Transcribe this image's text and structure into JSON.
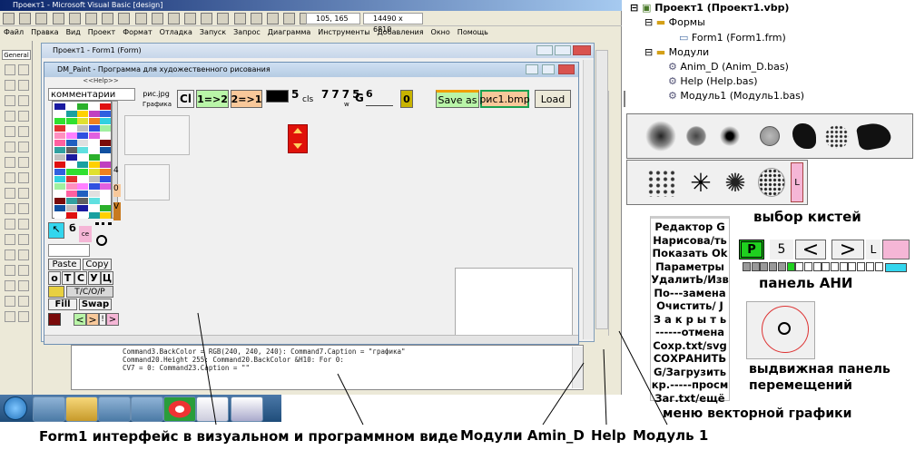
{
  "vb": {
    "title": "Проект1 - Microsoft Visual Basic [design]",
    "menu": [
      "Файл",
      "Правка",
      "Вид",
      "Проект",
      "Формат",
      "Отладка",
      "Запуск",
      "Запрос",
      "Диаграмма",
      "Инструменты",
      "Добавления",
      "Окно",
      "Помощь"
    ],
    "coords": "105, 165",
    "size": "14490 x 6810",
    "toolbox_tab": "General"
  },
  "form_window": {
    "title": "Проект1 - Form1 (Form)"
  },
  "app": {
    "title": "DM_Paint - Программа для художественного рисования",
    "help_link": "<<Help>>",
    "comment_box": "комментарии",
    "pic_label": "рис.jpg",
    "graphics_label": "Графика",
    "cl": "Cl",
    "b12": "1=>2",
    "b21": "2=>1",
    "n5": "5",
    "cls": "cls",
    "sevens": [
      "7",
      "7",
      "7",
      "5"
    ],
    "sub_w": "w",
    "g": "G",
    "six": "6",
    "zero": "0",
    "saveas": "Save as",
    "file": "рис1.bmp",
    "load": "Load",
    "paste": "Paste",
    "copy": "Copy",
    "letters": [
      "о",
      "Т",
      "С",
      "У",
      "Ц"
    ],
    "tcop": "Т/С/О/Р",
    "fill": "Fill",
    "swap": "Swap",
    "b_small": "б",
    "ce": "се",
    "side_nums": [
      "4",
      "0",
      "V"
    ],
    "arrow_l": "<",
    "arrow_r": ">",
    "bar": "!"
  },
  "code": {
    "line1": "Command3.BackColor = RGB(240, 240, 240): Command7.Caption = \"графика\"",
    "line2": "Command20.Height 255: Command20.BackColor  &H10: For   0:",
    "line3": "CV7 = 0: Command23.Caption = \"\""
  },
  "project": {
    "root": "Проект1 (Проект1.vbp)",
    "forms_folder": "Формы",
    "form1": "Form1 (Form1.frm)",
    "modules_folder": "Модули",
    "mod1": "Anim_D (Anim_D.bas)",
    "mod2": "Help (Help.bas)",
    "mod3": "Модуль1 (Модуль1.bas)"
  },
  "vector_menu": [
    "Редактор G",
    "Нарисова/ть",
    "Показать Ok",
    "Параметры",
    "УдалитЬ/Изв",
    "По---замена",
    "Очистить/ J",
    "З а к р ы т ь",
    "------отмена",
    "Сохр.txt/svg",
    "СОХРАНИТЬ",
    "G/Загрузить",
    "кр.-----просм",
    "Заг.txt/ещё"
  ],
  "ani": {
    "p": "P",
    "n": "5",
    "prev": "<",
    "next": ">",
    "l": "L"
  },
  "brush_l": "L",
  "captions": {
    "brushes": "выбор кистей",
    "ani_panel": "панель АНИ",
    "slide_panel": "выдвижная панель перемещений",
    "vector_menu": "меню векторной графики",
    "form1": "Form1 интерфейс в визуальном и программном виде",
    "modules": "Модули Amin_D",
    "help": "Help",
    "module1": "Модуль 1"
  },
  "colors": {
    "vb_chrome": "#ece9d8",
    "titlebar": "#0a246a",
    "green_btn": "#b9f5a8",
    "peach_btn": "#f8c89a",
    "olive": "#c8b400",
    "cyan": "#33d6ee",
    "pink": "#f5b6d6",
    "red_ctrl": "#e0120a",
    "taskbar": "#1f4d7a"
  }
}
